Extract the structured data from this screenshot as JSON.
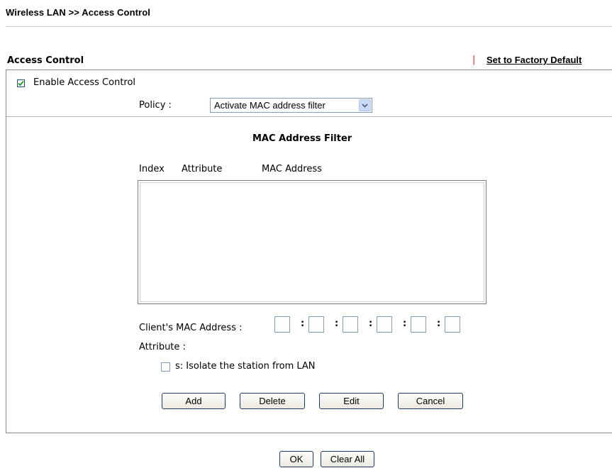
{
  "header": {
    "title": "Wireless LAN >> Access Control"
  },
  "section": {
    "title": "Access Control",
    "separator": "|",
    "factory_default_link": "Set to Factory Default"
  },
  "enable_access_control": {
    "label": "Enable Access Control",
    "checked": true
  },
  "policy": {
    "label": "Policy :",
    "selected": "Activate MAC address filter"
  },
  "mac_filter": {
    "title": "MAC Address Filter",
    "columns": [
      "Index",
      "Attribute",
      "MAC Address"
    ],
    "rows": []
  },
  "client_mac": {
    "label": "Client's MAC Address :",
    "separator": ":",
    "octets": [
      "",
      "",
      "",
      "",
      "",
      ""
    ]
  },
  "attribute": {
    "label": "Attribute :",
    "isolate_label": "s: Isolate the station from LAN",
    "isolate_checked": false
  },
  "buttons": {
    "add": "Add",
    "delete": "Delete",
    "edit": "Edit",
    "cancel": "Cancel",
    "ok": "OK",
    "clear_all": "Clear All"
  },
  "colors": {
    "accent_separator": "#e0261b",
    "checkbox_border": "#1c5180"
  }
}
